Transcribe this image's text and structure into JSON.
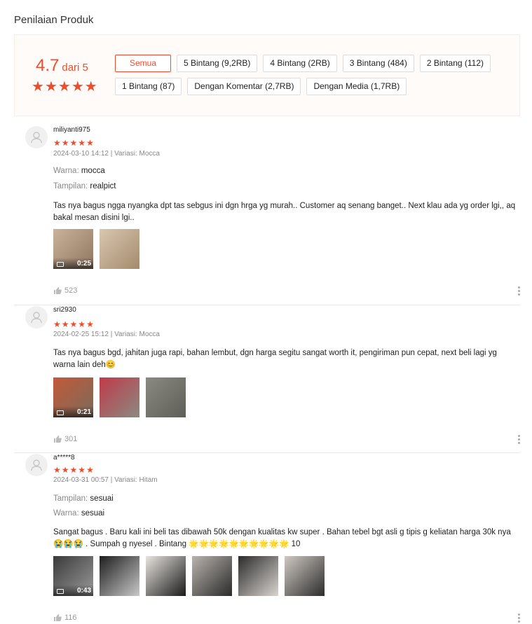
{
  "title": "Penilaian Produk",
  "overview": {
    "score": "4.7",
    "score_suffix": "dari 5",
    "rating_stars": 4.7,
    "filters": [
      {
        "label": "Semua",
        "active": true
      },
      {
        "label": "5 Bintang (9,2RB)",
        "active": false
      },
      {
        "label": "4 Bintang (2RB)",
        "active": false
      },
      {
        "label": "3 Bintang (484)",
        "active": false
      },
      {
        "label": "2 Bintang (112)",
        "active": false
      },
      {
        "label": "1 Bintang (87)",
        "active": false
      },
      {
        "label": "Dengan Komentar (2,7RB)",
        "active": false
      },
      {
        "label": "Dengan Media (1,7RB)",
        "active": false
      }
    ]
  },
  "reviews": [
    {
      "username": "miliyanti975",
      "stars": 5,
      "meta": "2024-03-10 14:12 | Variasi: Mocca",
      "attrs": [
        {
          "label": "Warna:",
          "value": "mocca"
        },
        {
          "label": "Tampilan:",
          "value": "realpict"
        }
      ],
      "text": "Tas nya bagus ngga nyangka dpt tas sebgus ini dgn hrga yg murah.. Customer aq senang banget.. Next klau ada yg order lgi,, aq bakal mesan disini lgi..",
      "emoji_tail": "",
      "media": [
        {
          "video": true,
          "duration": "0:25",
          "colors": [
            "#cbb39a",
            "#8d7560"
          ]
        },
        {
          "video": false,
          "duration": "",
          "colors": [
            "#d9c7b0",
            "#a48a6c"
          ]
        }
      ],
      "likes": "523"
    },
    {
      "username": "sri2930",
      "stars": 5,
      "meta": "2024-02-25 15:12 | Variasi: Mocca",
      "attrs": [],
      "text": "Tas nya bagus bgd, jahitan juga rapi, bahan lembut, dgn harga segitu sangat worth it, pengiriman pun cepat, next beli lagi yg warna lain deh",
      "emoji_tail": "😊",
      "media": [
        {
          "video": true,
          "duration": "0:21",
          "colors": [
            "#c25a3a",
            "#7a6a5a"
          ]
        },
        {
          "video": false,
          "duration": "",
          "colors": [
            "#c03a4a",
            "#8a8a80"
          ]
        },
        {
          "video": false,
          "duration": "",
          "colors": [
            "#8a8a82",
            "#5e5e58"
          ]
        }
      ],
      "likes": "301"
    },
    {
      "username": "a*****8",
      "stars": 5,
      "meta": "2024-03-31 00:57 | Variasi: Hitam",
      "attrs": [
        {
          "label": "Tampilan:",
          "value": "sesuai"
        },
        {
          "label": "Warna:",
          "value": "sesuai"
        }
      ],
      "text": "Sangat bagus . Baru kali ini beli tas dibawah 50k dengan kualitas kw super . Bahan tebel bgt asli g tipis g keliatan harga 30k nya 😭😭😭 . Sumpah g nyesel . Bintang 🌟🌟🌟🌟🌟🌟🌟🌟🌟🌟 10",
      "emoji_tail": "",
      "media": [
        {
          "video": true,
          "duration": "0:43",
          "colors": [
            "#3a3a3a",
            "#9a9a9a"
          ]
        },
        {
          "video": false,
          "duration": "",
          "colors": [
            "#1e1e1e",
            "#c8c8c8"
          ]
        },
        {
          "video": false,
          "duration": "",
          "colors": [
            "#e8e4df",
            "#1a1a1a"
          ]
        },
        {
          "video": false,
          "duration": "",
          "colors": [
            "#b9b3ad",
            "#2a2a2a"
          ]
        },
        {
          "video": false,
          "duration": "",
          "colors": [
            "#2b2b2b",
            "#d9d4cf"
          ]
        },
        {
          "video": false,
          "duration": "",
          "colors": [
            "#cfc9c2",
            "#2c2c2c"
          ]
        }
      ],
      "likes": "116"
    }
  ],
  "colors": {
    "accent": "#ee4d2d"
  }
}
